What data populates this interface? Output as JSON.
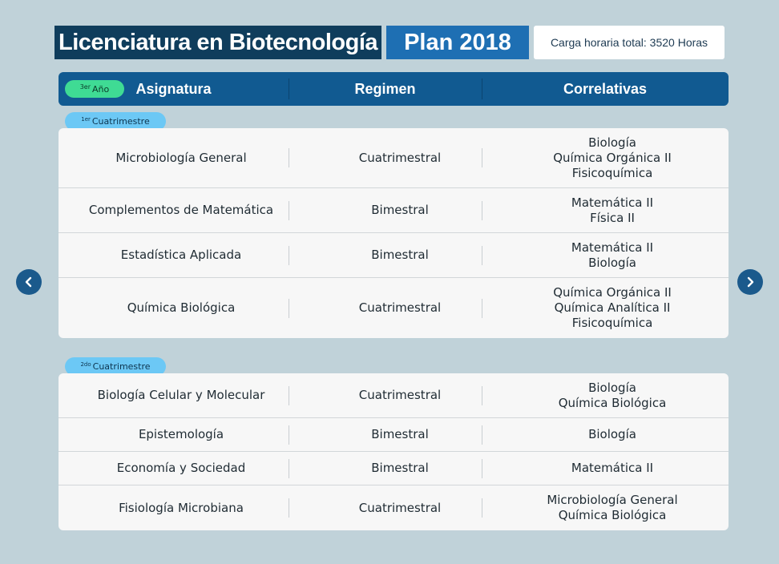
{
  "header": {
    "title": "Licenciatura en Biotecnología",
    "plan": "Plan 2018",
    "hours": "Carga horaria total: 3520 Horas"
  },
  "table_header": {
    "year_badge_sup": "3er",
    "year_badge_text": "Año",
    "col_subject": "Asignatura",
    "col_regime": "Regimen",
    "col_prereq": "Correlativas"
  },
  "semesters": [
    {
      "badge_sup": "1er",
      "badge_text": "Cuatrimestre",
      "rows": [
        {
          "subject": "Microbiología General",
          "regime": "Cuatrimestral",
          "prereqs": [
            "Biología",
            "Química Orgánica II",
            "Fisicoquímica"
          ]
        },
        {
          "subject": "Complementos de Matemática",
          "regime": "Bimestral",
          "prereqs": [
            "Matemática II",
            "Física II"
          ]
        },
        {
          "subject": "Estadística Aplicada",
          "regime": "Bimestral",
          "prereqs": [
            "Matemática II",
            "Biología"
          ]
        },
        {
          "subject": "Química Biológica",
          "regime": "Cuatrimestral",
          "prereqs": [
            "Química Orgánica II",
            "Química Analítica II",
            "Fisicoquímica"
          ]
        }
      ]
    },
    {
      "badge_sup": "2do",
      "badge_text": "Cuatrimestre",
      "rows": [
        {
          "subject": "Biología Celular y Molecular",
          "regime": "Cuatrimestral",
          "prereqs": [
            "Biología",
            "Química Biológica"
          ]
        },
        {
          "subject": "Epistemología",
          "regime": "Bimestral",
          "prereqs": [
            "Biología"
          ]
        },
        {
          "subject": "Economía y Sociedad",
          "regime": "Bimestral",
          "prereqs": [
            "Matemática II"
          ]
        },
        {
          "subject": "Fisiología Microbiana",
          "regime": "Cuatrimestral",
          "prereqs": [
            "Microbiología General",
            "Química Biológica"
          ]
        }
      ]
    }
  ],
  "nav": {
    "prev_icon": "chevron-left-icon",
    "next_icon": "chevron-right-icon"
  },
  "colors": {
    "background": "#c0d2d9",
    "title_dark": "#0f3d5c",
    "plan_blue": "#1e6fb3",
    "header_blue": "#115a91",
    "year_badge_green": "#3fdb94",
    "semester_badge_blue": "#6cc8f5",
    "nav_button": "#1b5a8c"
  }
}
